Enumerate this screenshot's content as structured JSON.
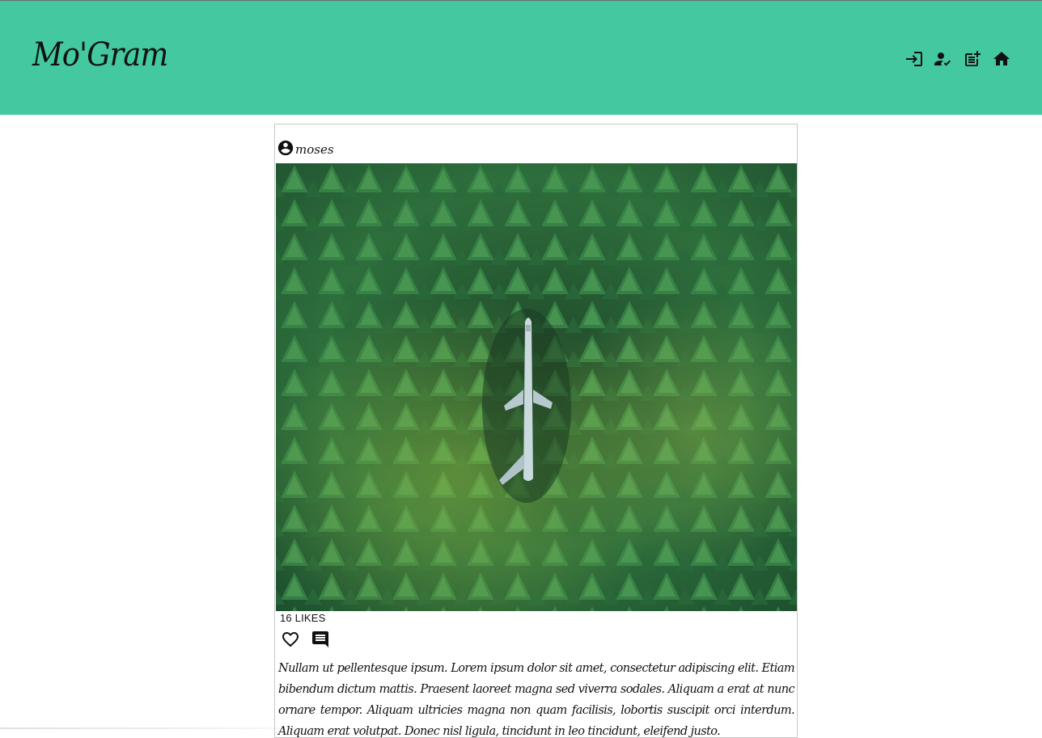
{
  "header": {
    "logo": "Mo'Gram",
    "background_color": "#43c8a0",
    "nav_icons": [
      "login-icon",
      "user-check-icon",
      "post-add-icon",
      "home-icon"
    ]
  },
  "post": {
    "username": "moses",
    "avatar_icon": "account-circle-icon",
    "image_description_icon": "post-photo",
    "likes": "16 LIKES",
    "actions": [
      "heart-icon",
      "comment-icon"
    ],
    "caption": "Nullam ut pellentesque ipsum. Lorem ipsum dolor sit amet, consectetur adipiscing elit. Etiam bibendum dictum mattis. Praesent laoreet magna sed viverra sodales. Aliquam a erat at nunc ornare tempor. Aliquam ultricies magna non quam facilisis, lobortis suscipit orci interdum. Aliquam erat volutpat. Donec nisl ligula, tincidunt in leo tincidunt, eleifend justo."
  }
}
